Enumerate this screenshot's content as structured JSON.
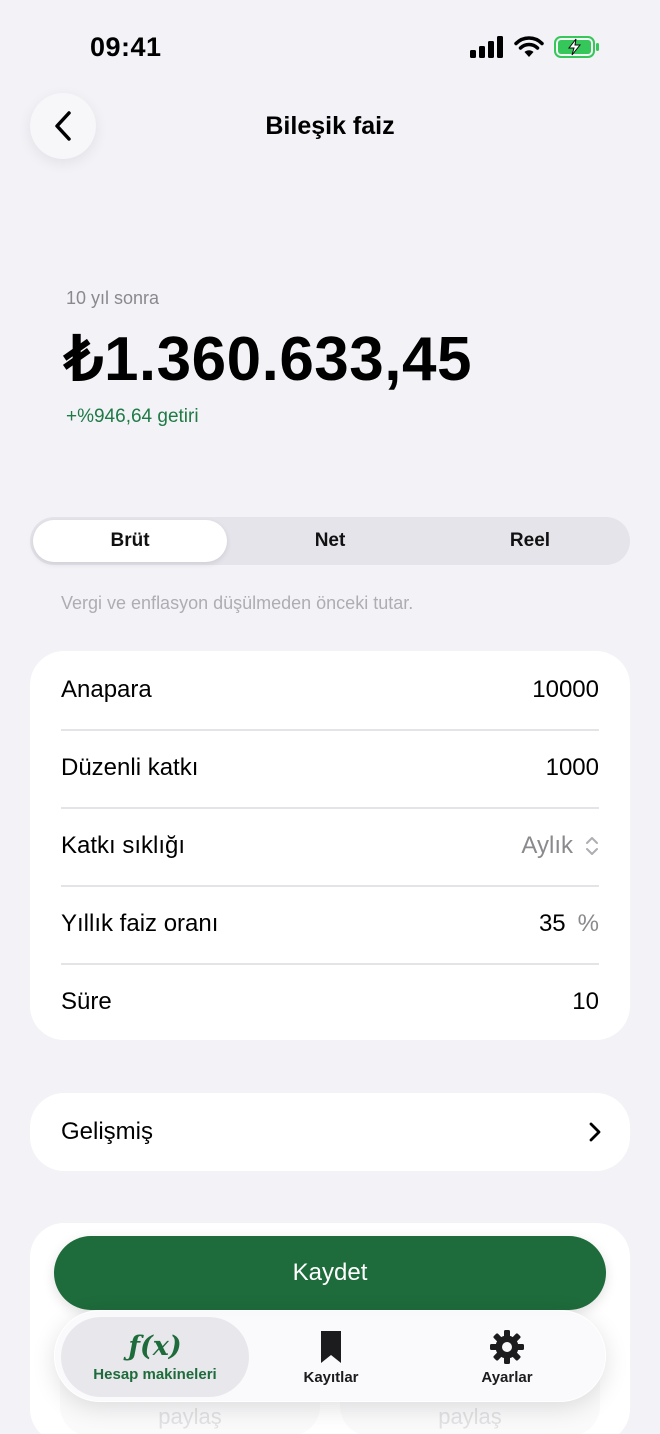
{
  "status_bar": {
    "time": "09:41"
  },
  "header": {
    "title": "Bileşik faiz"
  },
  "result": {
    "horizon_label": "10 yıl sonra",
    "amount": "₺1.360.633,45",
    "gain": "+%946,64 getiri"
  },
  "segments": {
    "items": [
      "Brüt",
      "Net",
      "Reel"
    ],
    "selected": "Brüt",
    "note": "Vergi ve enflasyon düşülmeden önceki tutar."
  },
  "form": {
    "principal": {
      "label": "Anapara",
      "value": "10000"
    },
    "contribution": {
      "label": "Düzenli katkı",
      "value": "1000"
    },
    "frequency": {
      "label": "Katkı sıklığı",
      "value": "Aylık"
    },
    "rate": {
      "label": "Yıllık faiz oranı",
      "value": "35",
      "unit": "%"
    },
    "duration": {
      "label": "Süre",
      "value": "10"
    }
  },
  "advanced": {
    "label": "Gelişmiş"
  },
  "save_button": {
    "label": "Kaydet"
  },
  "share_buttons": {
    "left": "paylaş",
    "right": "paylaş"
  },
  "tab_bar": {
    "items": [
      {
        "label": "Hesap makineleri",
        "icon": "fx-icon",
        "active": true
      },
      {
        "label": "Kayıtlar",
        "icon": "bookmark-icon",
        "active": false
      },
      {
        "label": "Ayarlar",
        "icon": "gear-icon",
        "active": false
      }
    ]
  },
  "colors": {
    "accent": "#1e6b3b",
    "gain": "#1f7a45",
    "background": "#f2f2f7"
  }
}
